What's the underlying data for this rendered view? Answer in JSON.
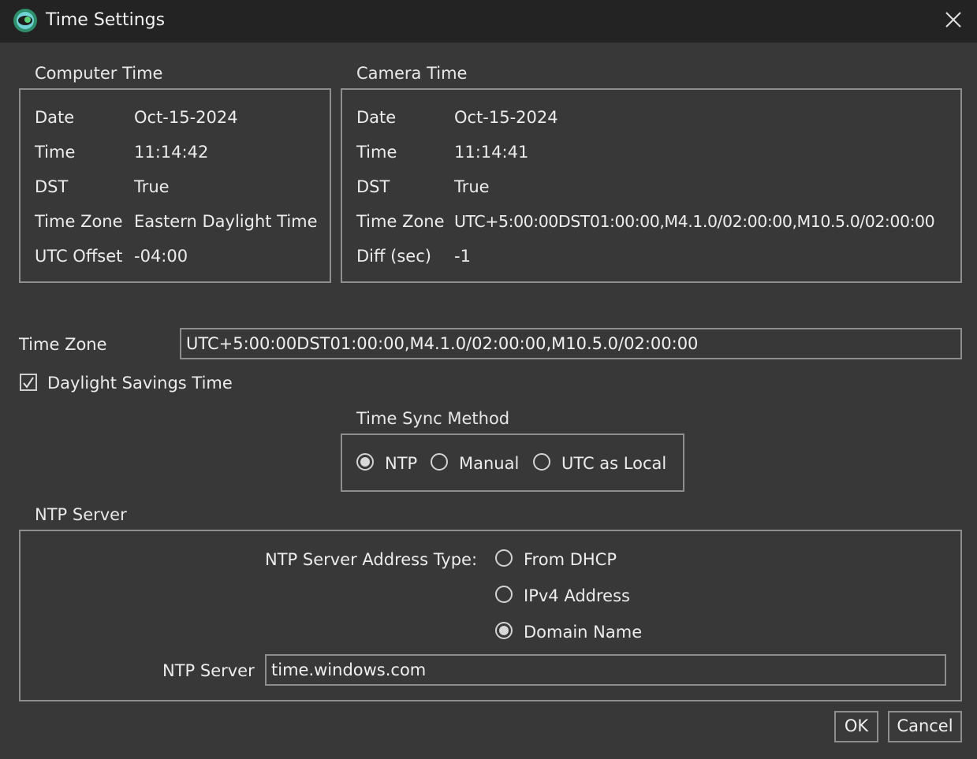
{
  "window": {
    "title": "Time Settings"
  },
  "computer_time": {
    "label": "Computer Time",
    "rows": [
      {
        "label": "Date",
        "value": "Oct-15-2024"
      },
      {
        "label": "Time",
        "value": "11:14:42"
      },
      {
        "label": "DST",
        "value": "True"
      },
      {
        "label": "Time Zone",
        "value": "Eastern Daylight Time"
      },
      {
        "label": "UTC Offset",
        "value": "-04:00"
      }
    ]
  },
  "camera_time": {
    "label": "Camera Time",
    "rows": [
      {
        "label": "Date",
        "value": "Oct-15-2024"
      },
      {
        "label": "Time",
        "value": "11:14:41"
      },
      {
        "label": "DST",
        "value": "True"
      },
      {
        "label": "Time Zone",
        "value": "UTC+5:00:00DST01:00:00,M4.1.0/02:00:00,M10.5.0/02:00:00"
      },
      {
        "label": "Diff (sec)",
        "value": "-1"
      }
    ]
  },
  "time_zone": {
    "label": "Time Zone",
    "value": "UTC+5:00:00DST01:00:00,M4.1.0/02:00:00,M10.5.0/02:00:00"
  },
  "dst_checkbox": {
    "label": "Daylight Savings Time",
    "checked": true
  },
  "sync_method": {
    "label": "Time Sync Method",
    "options": [
      {
        "label": "NTP",
        "selected": true
      },
      {
        "label": "Manual",
        "selected": false
      },
      {
        "label": "UTC as Local",
        "selected": false
      }
    ]
  },
  "ntp_server": {
    "group_label": "NTP Server",
    "address_type_label": "NTP Server Address Type:",
    "address_types": [
      {
        "label": "From DHCP",
        "selected": false
      },
      {
        "label": "IPv4 Address",
        "selected": false
      },
      {
        "label": "Domain Name",
        "selected": true
      }
    ],
    "server_label": "NTP Server",
    "server_value": "time.windows.com"
  },
  "buttons": {
    "ok": "OK",
    "cancel": "Cancel"
  },
  "colors": {
    "background": "#383838",
    "titlebar": "#232323",
    "border": "#8e8e8e",
    "text": "#ececec"
  }
}
